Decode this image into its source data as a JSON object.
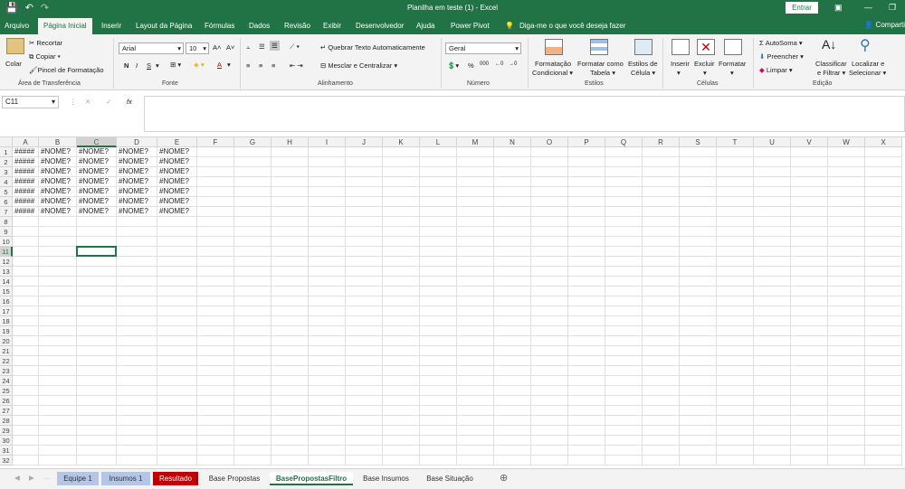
{
  "titlebar": {
    "title": "Planilha em teste (1)  -  Excel",
    "entrar": "Entrar",
    "save_icon": "save-icon",
    "undo_icon": "undo-icon",
    "redo_icon": "redo-icon"
  },
  "tabs": [
    "Arquivo",
    "Página Inicial",
    "Inserir",
    "Layout da Página",
    "Fórmulas",
    "Dados",
    "Revisão",
    "Exibir",
    "Desenvolvedor",
    "Ajuda",
    "Power Pivot"
  ],
  "active_tab": "Página Inicial",
  "tellme": "Diga-me o que você deseja fazer",
  "share": "Comparti",
  "ribbon": {
    "clipboard": {
      "paste": "Colar",
      "cut": "Recortar",
      "copy": "Copiar",
      "painter": "Pincel de Formatação",
      "label": "Área de Transferência"
    },
    "font": {
      "name": "Arial",
      "size": "10",
      "label": "Fonte",
      "bold": "N",
      "italic": "I",
      "underline": "S"
    },
    "alignment": {
      "wrap": "Quebrar Texto Automaticamente",
      "merge": "Mesclar e Centralizar",
      "label": "Alinhamento"
    },
    "number": {
      "format": "Geral",
      "label": "Número",
      "percent": "%",
      "thousands": "000"
    },
    "styles": {
      "cond1": "Formatação",
      "cond2": "Condicional",
      "table1": "Formatar como",
      "table2": "Tabela",
      "cell1": "Estilos de",
      "cell2": "Célula",
      "label": "Estilos"
    },
    "cells": {
      "insert": "Inserir",
      "delete": "Excluir",
      "format": "Formatar",
      "label": "Células"
    },
    "editing": {
      "autosum": "AutoSoma",
      "fill": "Preencher",
      "clear": "Limpar",
      "sort1": "Classificar",
      "sort2": "e Filtrar",
      "find1": "Localizar e",
      "find2": "Selecionar",
      "label": "Edição"
    }
  },
  "formula": {
    "namebox": "C11",
    "fx": "fx",
    "value": ""
  },
  "columns": [
    "A",
    "B",
    "C",
    "D",
    "E",
    "F",
    "G",
    "H",
    "I",
    "J",
    "K",
    "L",
    "M",
    "N",
    "O",
    "P",
    "Q",
    "R",
    "S",
    "T",
    "U",
    "V",
    "W",
    "X"
  ],
  "rows": [
    "1",
    "2",
    "3",
    "4",
    "5",
    "6",
    "7",
    "8",
    "9",
    "10",
    "11",
    "12",
    "13",
    "14",
    "15",
    "16",
    "17",
    "18",
    "19",
    "20",
    "21",
    "22",
    "23",
    "24",
    "25",
    "26",
    "27",
    "28",
    "29",
    "30",
    "31",
    "32"
  ],
  "data_rows": [
    [
      "#####",
      "#NOME?",
      "#NOME?",
      "#NOME?",
      "#NOME?"
    ],
    [
      "#####",
      "#NOME?",
      "#NOME?",
      "#NOME?",
      "#NOME?"
    ],
    [
      "#####",
      "#NOME?",
      "#NOME?",
      "#NOME?",
      "#NOME?"
    ],
    [
      "#####",
      "#NOME?",
      "#NOME?",
      "#NOME?",
      "#NOME?"
    ],
    [
      "#####",
      "#NOME?",
      "#NOME?",
      "#NOME?",
      "#NOME?"
    ],
    [
      "#####",
      "#NOME?",
      "#NOME?",
      "#NOME?",
      "#NOME?"
    ],
    [
      "#####",
      "#NOME?",
      "#NOME?",
      "#NOME?",
      "#NOME?"
    ]
  ],
  "selected_cell": "C11",
  "sheets": [
    {
      "name": "Equipe 1",
      "color": "#b4c6e7",
      "active": false
    },
    {
      "name": "Insumos 1",
      "color": "#b4c6e7",
      "active": false
    },
    {
      "name": "Resultado",
      "color": "#c00000",
      "active": false
    },
    {
      "name": "Base Propostas",
      "color": "",
      "active": false
    },
    {
      "name": "BasePropostasFiltro",
      "color": "",
      "active": true
    },
    {
      "name": "Base Insumos",
      "color": "",
      "active": false
    },
    {
      "name": "Base Situação",
      "color": "",
      "active": false
    }
  ],
  "add_sheet": "⊕",
  "colors": {
    "excel_green": "#217346"
  }
}
